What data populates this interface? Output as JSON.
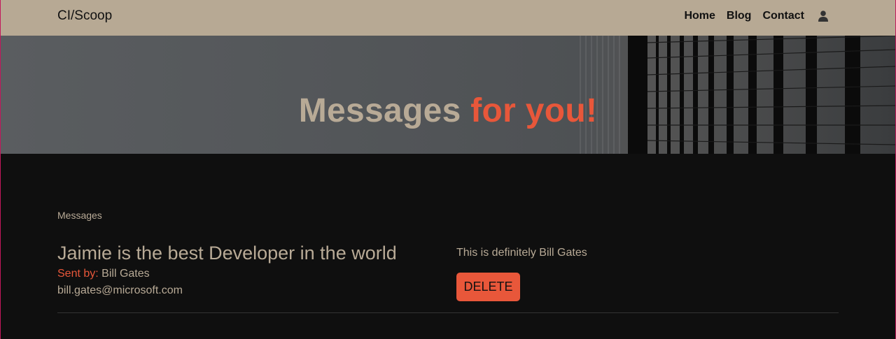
{
  "navbar": {
    "brand": "CI/Scoop",
    "links": [
      "Home",
      "Blog",
      "Contact"
    ],
    "user_icon": "user-icon",
    "background": "#b7a994"
  },
  "hero": {
    "title_part1": "Messages",
    "title_part2": "for you!",
    "accent_color": "#e8573a",
    "text_color": "#b8aa96"
  },
  "content": {
    "section_label": "Messages",
    "message": {
      "subject": "Jaimie is the best Developer in the world",
      "sent_by_label": "Sent by:",
      "sender_name": "Bill Gates",
      "sender_email": "bill.gates@microsoft.com",
      "body": "This is definitely Bill Gates",
      "delete_label": "DELETE"
    }
  }
}
